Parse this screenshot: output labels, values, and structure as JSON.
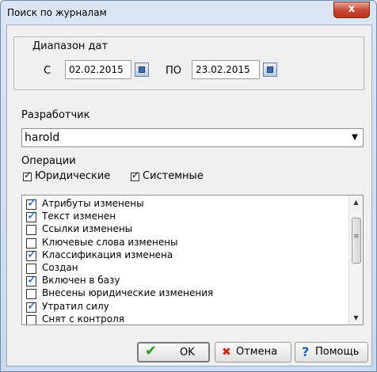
{
  "window": {
    "title": "Поиск по журналам",
    "close_label": "x"
  },
  "date_range": {
    "legend": "Диапазон дат",
    "from_label": "С",
    "from_value": "02.02.2015",
    "to_label": "ПО",
    "to_value": "23.02.2015"
  },
  "developer": {
    "label": "Разработчик",
    "value": "harold"
  },
  "operations": {
    "label": "Операции",
    "legal_label": "Юридические",
    "legal_checked": true,
    "system_label": "Системные",
    "system_checked": true
  },
  "list": {
    "items": [
      {
        "label": "Атрибуты изменены",
        "checked": true
      },
      {
        "label": "Текст изменен",
        "checked": true
      },
      {
        "label": "Ссылки изменены",
        "checked": false
      },
      {
        "label": "Ключевые слова изменены",
        "checked": false
      },
      {
        "label": "Классификация изменена",
        "checked": true
      },
      {
        "label": "Создан",
        "checked": false
      },
      {
        "label": "Включен в базу",
        "checked": true
      },
      {
        "label": "Внесены юридические изменения",
        "checked": false
      },
      {
        "label": "Утратил силу",
        "checked": true
      },
      {
        "label": "Снят с контроля",
        "checked": false
      }
    ]
  },
  "buttons": {
    "ok": "OK",
    "cancel": "Отмена",
    "help": "Помощь"
  },
  "icons": {
    "ok": "check-icon",
    "cancel": "x-icon",
    "help": "question-icon",
    "calendar": "calendar-icon"
  },
  "colors": {
    "title_bar": "#c9d9ee",
    "close": "#c5452d",
    "ok_check": "#2e9a1f",
    "cancel_x": "#c62b18",
    "help_q": "#1f5fbf"
  }
}
